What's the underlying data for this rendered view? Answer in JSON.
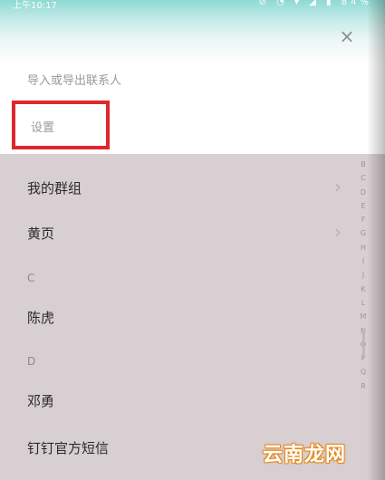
{
  "status_bar": {
    "time": "上午10:17",
    "icons": "⊘ ◔ ▾ ◢ ▮",
    "battery": "84%"
  },
  "menu": {
    "close_glyph": "×",
    "import_export": "导入或导出联系人",
    "settings": "设置"
  },
  "contacts": {
    "groups": "我的群组",
    "yellow_pages": "黄页",
    "sections": [
      {
        "letter": "C",
        "items": [
          "陈虎"
        ]
      },
      {
        "letter": "D",
        "items": [
          "邓勇",
          "钉钉官方短信"
        ]
      }
    ],
    "chevron": "›"
  },
  "index_letters": [
    "B",
    "C",
    "D",
    "E",
    "F",
    "G",
    "H",
    "I",
    "J",
    "K",
    "L",
    "M",
    "N",
    "O",
    "P",
    "Q",
    "R"
  ],
  "watermark": "云南龙网",
  "colors": {
    "highlight": "#e2262b",
    "dim_overlay": "#d8cfd3",
    "top_gradient": "#8fd9d3"
  }
}
